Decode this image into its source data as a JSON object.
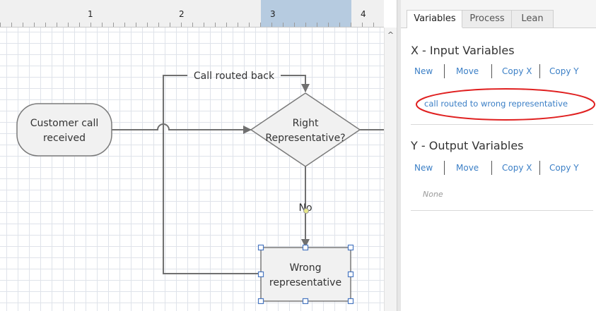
{
  "ruler": {
    "marks": [
      "1",
      "2",
      "3",
      "4"
    ]
  },
  "flowchart": {
    "start_node": [
      "Customer call",
      "received"
    ],
    "decision_node": [
      "Right",
      "Representative?"
    ],
    "process_node": [
      "Wrong",
      "representative"
    ],
    "loop_label": "Call routed back",
    "no_label": "No"
  },
  "panel": {
    "tabs": [
      "Variables",
      "Process",
      "Lean"
    ],
    "input": {
      "title": "X - Input Variables",
      "actions": [
        "New",
        "Move",
        "Copy X",
        "Copy Y"
      ],
      "items": [
        "call routed to wrong representative"
      ]
    },
    "output": {
      "title": "Y - Output Variables",
      "actions": [
        "New",
        "Move",
        "Copy X",
        "Copy Y"
      ],
      "empty_text": "None"
    }
  },
  "colors": {
    "link": "#3b7fc6",
    "highlight_ellipse": "#e02020",
    "connector": "#707070",
    "selection_handle": "#4a78c2",
    "ruler_highlight": "#b6cbe0"
  },
  "icons": {
    "scroll_up": "chevron-up-icon"
  }
}
